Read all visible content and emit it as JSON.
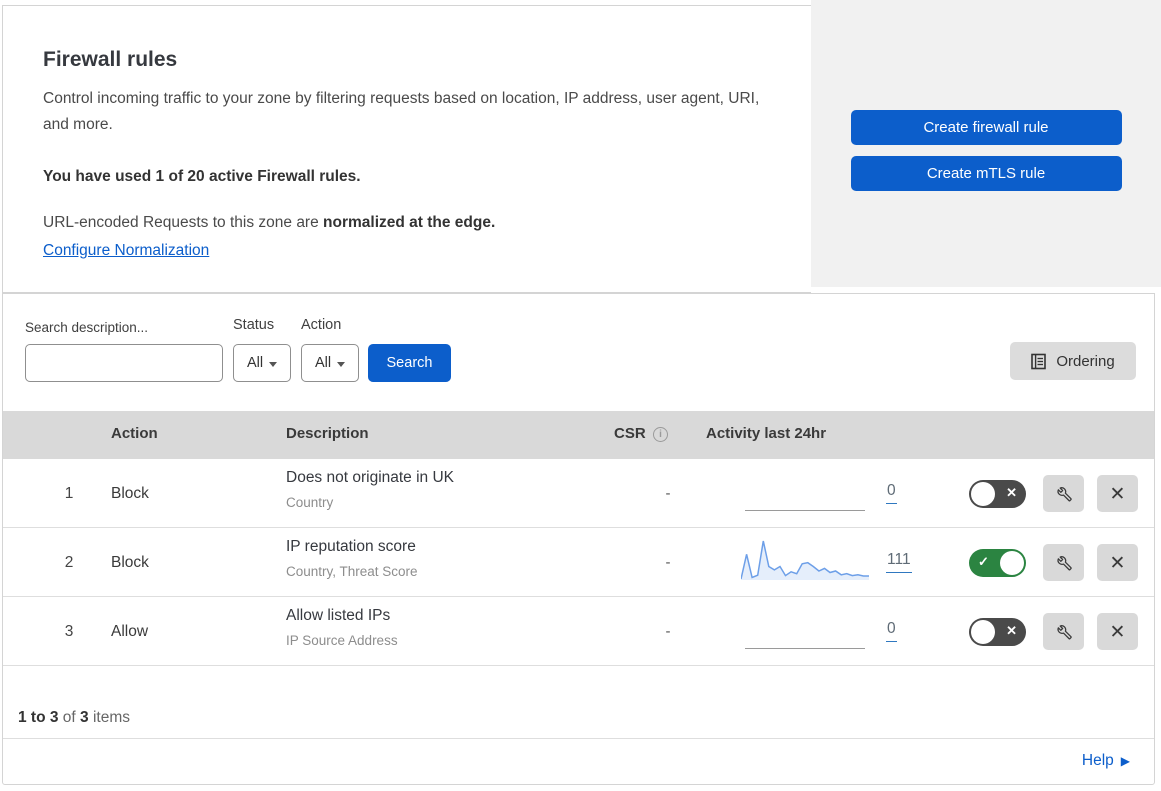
{
  "header": {
    "title": "Firewall rules",
    "description": "Control incoming traffic to your zone by filtering requests based on location, IP address, user agent, URI, and more.",
    "usage_line": "You have used 1 of 20 active Firewall rules.",
    "normalization_prefix": "URL-encoded Requests to this zone are ",
    "normalization_bold": "normalized at the edge.",
    "normalization_link": "Configure Normalization"
  },
  "actions_panel": {
    "create_firewall_rule_label": "Create firewall rule",
    "create_mtls_rule_label": "Create mTLS rule"
  },
  "filters": {
    "search_label": "Search description...",
    "search_placeholder": "",
    "search_value": "",
    "status_label": "Status",
    "status_value": "All",
    "action_label": "Action",
    "action_value": "All",
    "search_button_label": "Search",
    "ordering_button_label": "Ordering"
  },
  "table": {
    "columns": {
      "action": "Action",
      "description": "Description",
      "csr": "CSR",
      "csr_info_icon": "i",
      "activity": "Activity last 24hr"
    },
    "rows": [
      {
        "priority": "1",
        "action": "Block",
        "description": "Does not originate in UK",
        "fields": "Country",
        "csr": "-",
        "activity_count": "0",
        "enabled": false,
        "sparkline": []
      },
      {
        "priority": "2",
        "action": "Block",
        "description": "IP reputation score",
        "fields": "Country, Threat Score",
        "csr": "-",
        "activity_count": "111",
        "enabled": true,
        "sparkline": [
          0,
          65,
          4,
          10,
          100,
          33,
          24,
          33,
          9,
          19,
          14,
          40,
          43,
          33,
          21,
          28,
          17,
          21,
          11,
          14,
          9,
          11,
          8,
          8
        ]
      },
      {
        "priority": "3",
        "action": "Allow",
        "description": "Allow listed IPs",
        "fields": "IP Source Address",
        "csr": "-",
        "activity_count": "0",
        "enabled": false,
        "sparkline": []
      }
    ]
  },
  "footer": {
    "range_bold": "1 to 3",
    "of_text": " of ",
    "total_bold": "3",
    "items_text": " items",
    "help_label": "Help",
    "help_arrow": "▶"
  },
  "glyphs": {
    "toggle_off_x": "✕",
    "toggle_on_check": "✓",
    "delete_x": "✕"
  },
  "colors": {
    "accent_blue": "#0c5ecb",
    "toggle_on_green": "#2b8441",
    "toggle_off_gray": "#4a4a4a",
    "sparkline_blue": "#6d9fe8",
    "table_header_gray": "#d9d9d9",
    "side_panel_gray": "#f1f1f1"
  }
}
